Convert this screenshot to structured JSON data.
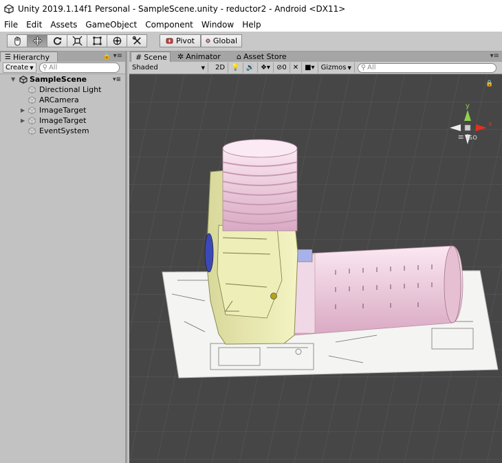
{
  "window": {
    "title": "Unity 2019.1.14f1 Personal - SampleScene.unity - reductor2 - Android <DX11>"
  },
  "menu": [
    "File",
    "Edit",
    "Assets",
    "GameObject",
    "Component",
    "Window",
    "Help"
  ],
  "toolbar": {
    "pivot_label": "Pivot",
    "global_label": "Global"
  },
  "hierarchy": {
    "tab_label": "Hierarchy",
    "create_label": "Create",
    "search_placeholder": "All",
    "scene_name": "SampleScene",
    "items": [
      {
        "label": "Directional Light",
        "expandable": false
      },
      {
        "label": "ARCamera",
        "expandable": false
      },
      {
        "label": "ImageTarget",
        "expandable": true
      },
      {
        "label": "ImageTarget",
        "expandable": true
      },
      {
        "label": "EventSystem",
        "expandable": false
      }
    ]
  },
  "scene_view": {
    "tabs": [
      "Scene",
      "Animator",
      "Asset Store"
    ],
    "shading_mode": "Shaded",
    "mode_2d_label": "2D",
    "effects_count": "0",
    "gizmos_label": "Gizmos",
    "search_placeholder": "All",
    "projection_label": "Iso",
    "gizmo_axes": {
      "y": "y",
      "x": "x"
    }
  },
  "colors": {
    "viewport_bg": "#464646",
    "model_yellow": "#f1f1b8",
    "model_pink": "#f2d2e3",
    "axis_x": "#e0311f",
    "axis_y": "#8fd14f"
  }
}
